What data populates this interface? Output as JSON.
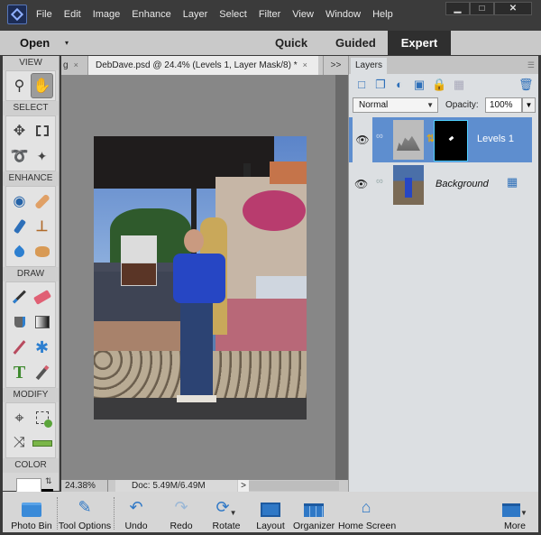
{
  "menu": [
    "File",
    "Edit",
    "Image",
    "Enhance",
    "Layer",
    "Select",
    "Filter",
    "View",
    "Window",
    "Help"
  ],
  "window_controls": {
    "minimize": "▁",
    "maximize": "□",
    "close": "✕"
  },
  "modebar": {
    "open": "Open",
    "open_caret": "▾",
    "quick": "Quick",
    "guided": "Guided",
    "expert": "Expert"
  },
  "toolbox": {
    "sections": [
      {
        "title": "VIEW",
        "tools": [
          {
            "name": "zoom-tool",
            "glyph": "🔍"
          },
          {
            "name": "hand-tool",
            "glyph": "✋",
            "active": true
          }
        ]
      },
      {
        "title": "SELECT",
        "tools": [
          {
            "name": "move-tool",
            "glyph": "✥"
          },
          {
            "name": "marquee-tool",
            "glyph": "⬚"
          },
          {
            "name": "lasso-tool",
            "glyph": "➰"
          },
          {
            "name": "quick-selection-tool",
            "glyph": "✎"
          }
        ]
      },
      {
        "title": "ENHANCE",
        "tools": [
          {
            "name": "red-eye-tool",
            "glyph": "👁"
          },
          {
            "name": "spot-healing-tool",
            "glyph": "🩹"
          },
          {
            "name": "smart-brush-tool",
            "glyph": "🖌"
          },
          {
            "name": "clone-stamp-tool",
            "glyph": "⊥"
          },
          {
            "name": "blur-tool",
            "glyph": "💧"
          },
          {
            "name": "sponge-tool",
            "glyph": "●"
          }
        ]
      },
      {
        "title": "DRAW",
        "tools": [
          {
            "name": "brush-tool",
            "glyph": "🖌"
          },
          {
            "name": "eraser-tool",
            "glyph": "▰"
          },
          {
            "name": "paint-bucket-tool",
            "glyph": "🪣"
          },
          {
            "name": "gradient-tool",
            "glyph": "▦"
          },
          {
            "name": "eyedropper-tool",
            "glyph": "💉"
          },
          {
            "name": "custom-shape-tool",
            "glyph": "✱"
          },
          {
            "name": "type-tool",
            "glyph": "T"
          },
          {
            "name": "pencil-tool",
            "glyph": "✏"
          }
        ]
      },
      {
        "title": "MODIFY",
        "tools": [
          {
            "name": "crop-tool",
            "glyph": "⌗"
          },
          {
            "name": "recompose-tool",
            "glyph": "⚙"
          },
          {
            "name": "content-aware-move-tool",
            "glyph": "⤨"
          },
          {
            "name": "straighten-tool",
            "glyph": "▬"
          }
        ]
      }
    ],
    "color_title": "COLOR"
  },
  "doc_tabs": {
    "prev": "g",
    "active": "DebDave.psd @ 24.4% (Levels 1, Layer Mask/8) *",
    "close": "×",
    "more": ">>"
  },
  "status": {
    "zoom": "24.38%",
    "doc": "Doc: 5.49M/6.49M",
    "arrow": ">"
  },
  "layers_panel": {
    "tab": "Layers",
    "blend_mode": "Normal",
    "opacity_label": "Opacity:",
    "opacity": "100%",
    "layers": [
      {
        "name": "Levels 1",
        "selected": true,
        "type": "adjustment"
      },
      {
        "name": "Background",
        "selected": false,
        "type": "image",
        "locked": true
      }
    ]
  },
  "bottom_bar": [
    {
      "label": "Photo Bin",
      "icon": "photo-bin-icon"
    },
    {
      "label": "Tool Options",
      "icon": "tool-options-icon"
    },
    {
      "label": "Undo",
      "icon": "undo-icon"
    },
    {
      "label": "Redo",
      "icon": "redo-icon"
    },
    {
      "label": "Rotate",
      "icon": "rotate-icon"
    },
    {
      "label": "Layout",
      "icon": "layout-icon"
    },
    {
      "label": "Organizer",
      "icon": "organizer-icon"
    },
    {
      "label": "Home Screen",
      "icon": "home-icon"
    },
    {
      "label": "More",
      "icon": "more-icon"
    }
  ]
}
